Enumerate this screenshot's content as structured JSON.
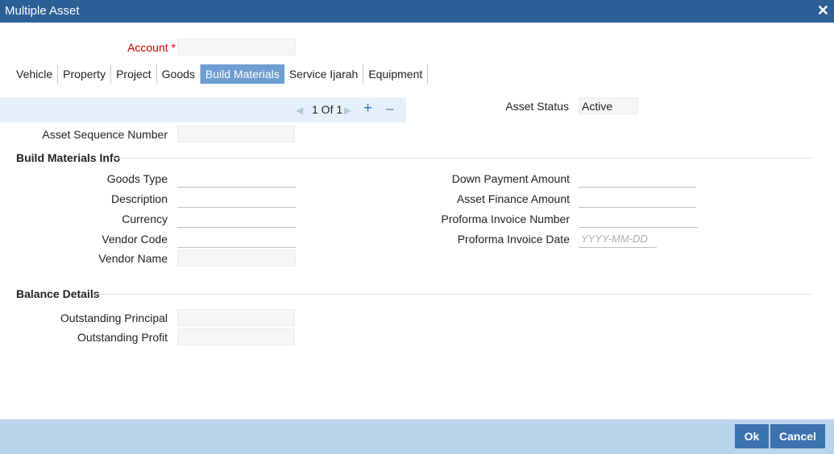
{
  "window": {
    "title": "Multiple Asset",
    "close_symbol": "✕"
  },
  "account": {
    "label": "Account *"
  },
  "tabs": [
    "Vehicle",
    "Property",
    "Project",
    "Goods",
    "Build Materials",
    "Service Ijarah",
    "Equipment"
  ],
  "active_tab": "Build Materials",
  "pager": {
    "text": "1 Of 1",
    "prev_symbol": "◀",
    "next_symbol": "▶",
    "add_symbol": "+",
    "remove_symbol": "–"
  },
  "asset_status": {
    "label": "Asset Status",
    "value": "Active"
  },
  "asset_sequence": {
    "label": "Asset Sequence Number"
  },
  "build_materials_info": {
    "title": "Build Materials Info",
    "goods_type": "Goods Type",
    "description": "Description",
    "currency": "Currency",
    "vendor_code": "Vendor Code",
    "vendor_name": "Vendor Name",
    "down_payment": "Down Payment Amount",
    "asset_finance": "Asset Finance Amount",
    "proforma_number": "Proforma Invoice Number",
    "proforma_date": "Proforma Invoice Date",
    "proforma_date_placeholder": "YYYY-MM-DD"
  },
  "balance_details": {
    "title": "Balance Details",
    "outstanding_principal": "Outstanding Principal",
    "outstanding_profit": "Outstanding Profit"
  },
  "buttons": {
    "ok": "Ok",
    "cancel": "Cancel"
  }
}
